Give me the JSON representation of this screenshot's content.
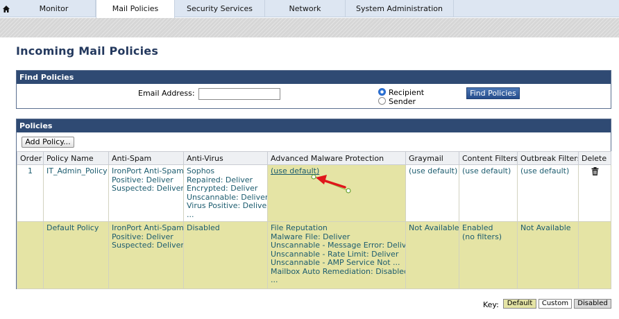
{
  "nav": {
    "tabs": [
      {
        "label": "Monitor"
      },
      {
        "label": "Mail Policies",
        "active": true
      },
      {
        "label": "Security Services"
      },
      {
        "label": "Network"
      },
      {
        "label": "System Administration"
      }
    ]
  },
  "page": {
    "title": "Incoming Mail Policies"
  },
  "find": {
    "header": "Find Policies",
    "email_label": "Email Address:",
    "email_value": "",
    "radio_recipient": "Recipient",
    "radio_sender": "Sender",
    "selected_radio": "Recipient",
    "button": "Find Policies"
  },
  "policies": {
    "header": "Policies",
    "add_button": "Add Policy...",
    "columns": [
      "Order",
      "Policy Name",
      "Anti-Spam",
      "Anti-Virus",
      "Advanced Malware Protection",
      "Graymail",
      "Content Filters",
      "Outbreak Filters",
      "Delete"
    ],
    "rows": [
      {
        "order": "1",
        "name": "IT_Admin_Policy",
        "anti_spam": [
          "IronPort Anti-Spam",
          "Positive: Deliver",
          "Suspected: Deliver"
        ],
        "anti_virus": [
          "Sophos",
          "Repaired: Deliver",
          "Encrypted: Deliver",
          "Unscannable: Deliver",
          "Virus Positive: Deliver",
          "..."
        ],
        "amp": [
          "(use default)"
        ],
        "graymail": "(use default)",
        "content_filters": "(use default)",
        "outbreak_filters": "(use default)"
      },
      {
        "order": "",
        "name": "Default Policy",
        "anti_spam": [
          "IronPort Anti-Spam",
          "Positive: Deliver",
          "Suspected: Deliver"
        ],
        "anti_virus": [
          "Disabled"
        ],
        "amp": [
          "File Reputation",
          "Malware File: Deliver",
          "Unscannable - Message Error: Deliver",
          "Unscannable - Rate Limit: Deliver",
          "Unscannable - AMP Service Not ...",
          "Mailbox Auto Remediation: Disabled",
          "..."
        ],
        "graymail": "Not Available",
        "content_filters": [
          "Enabled",
          "(no filters)"
        ],
        "outbreak_filters": "Not Available"
      }
    ]
  },
  "key": {
    "label": "Key:",
    "default": "Default",
    "custom": "Custom",
    "disabled": "Disabled"
  },
  "colors": {
    "header_blue": "#2f4a73",
    "title_blue": "#24395e",
    "default_yellow": "#e5e4a5",
    "link_teal": "#1b5b6e",
    "annotation_red": "#e0161b"
  }
}
